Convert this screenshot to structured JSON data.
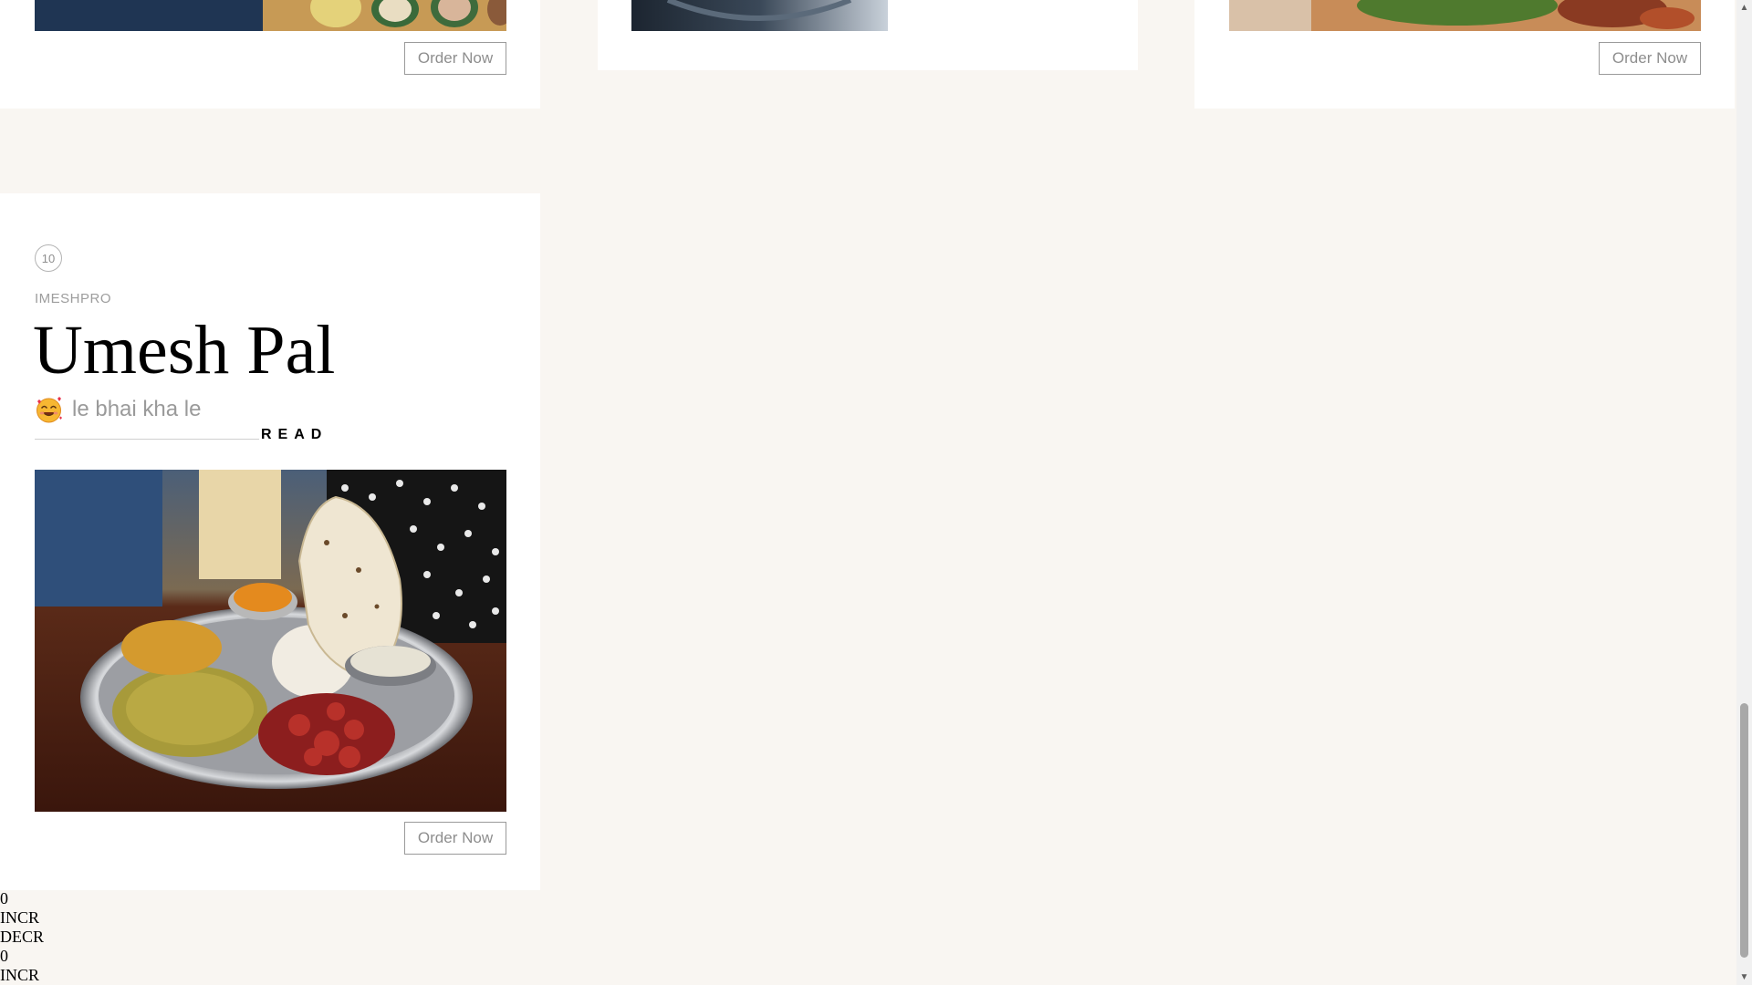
{
  "cards": {
    "top_left": {
      "button_label": "Order Now"
    },
    "top_right": {
      "button_label": "Order Now"
    }
  },
  "post": {
    "number": "10",
    "author": "IMESHPRO",
    "title": "Umesh Pal",
    "subtitle": "le bhai kha le",
    "read_label": "READ",
    "button_label": "Order Now",
    "image_icon": "thali-plate-image",
    "emoji_icon": "smiling-face-with-hearts-icon"
  },
  "counters": [
    {
      "value": "0",
      "incr_label": "INCR",
      "decr_label": "DECR"
    },
    {
      "value": "0",
      "incr_label": "INCR"
    }
  ],
  "colors": {
    "page_background": "#f9f6f2",
    "card_background": "#ffffff",
    "button_border": "#9a9a9a",
    "button_text": "#8e8e8e"
  }
}
